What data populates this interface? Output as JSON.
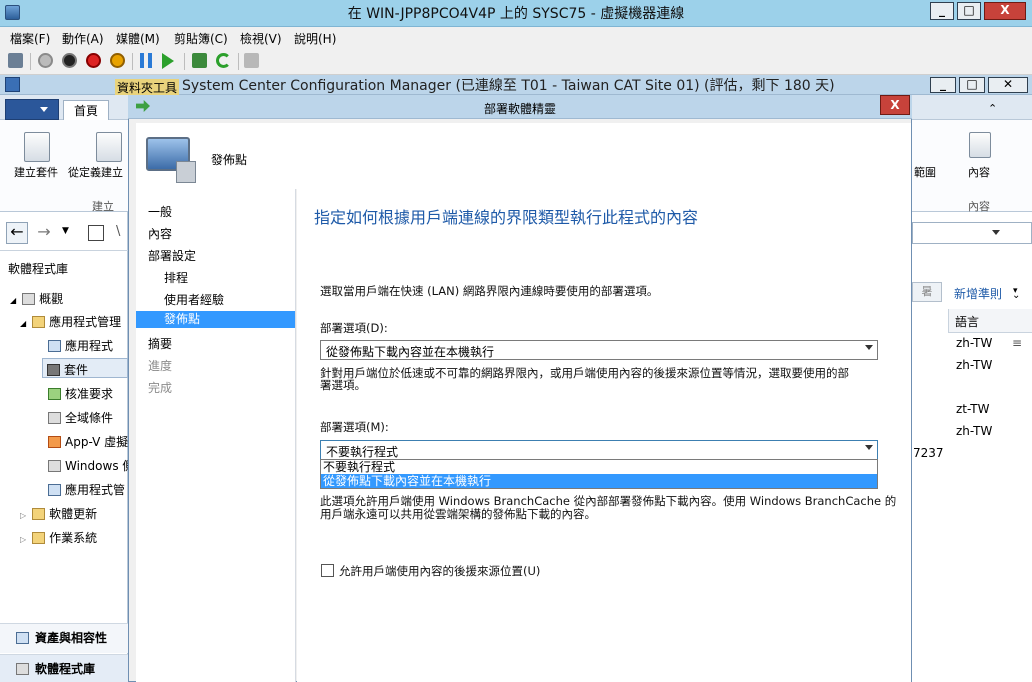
{
  "vm": {
    "title": "在 WIN-JPP8PCO4V4P 上的 SYSC75 - 虛擬機器連線",
    "win_min": "_",
    "win_max": "□",
    "win_close": "X",
    "menu": [
      "檔案(F)",
      "動作(A)",
      "媒體(M)",
      "剪貼簿(C)",
      "檢視(V)",
      "說明(H)"
    ]
  },
  "sccm": {
    "folder_tools": "資料夾工具",
    "title": "System Center Configuration Manager (已連線至 T01 - Taiwan CAT Site 01) (評估，剩下 180 天)",
    "home_tab": "首頁",
    "ribbon_create_package": "建立套件",
    "ribbon_create_from_def": "從定義建立",
    "ribbon_group_create": "建立",
    "ribbon_scope": "範圍",
    "ribbon_content": "內容",
    "ribbon_group_content": "內容",
    "nav_title": "軟體程式庫",
    "tree": {
      "overview": "概觀",
      "app_mgmt": "應用程式管理",
      "applications": "應用程式",
      "packages": "套件",
      "approval": "核准要求",
      "global_conditions": "全域條件",
      "appv": "App-V 虛擬",
      "windows_side": "Windows 側",
      "app_mgmt2": "應用程式管",
      "software_updates": "軟體更新",
      "os": "作業系統"
    },
    "ws_assets": "資產與相容性",
    "ws_library": "軟體程式庫",
    "right": {
      "new_rule": "新增準則",
      "filter_btn": "暑",
      "col_lang": "語言",
      "rows": [
        "zh-TW",
        "zh-TW",
        "zt-TW",
        "zh-TW"
      ],
      "partial_id": "7237"
    }
  },
  "wizard": {
    "title": "部署軟體精靈",
    "close": "X",
    "page_header": "發佈點",
    "steps": [
      {
        "label": "一般"
      },
      {
        "label": "內容"
      },
      {
        "label": "部署設定"
      },
      {
        "label": "排程"
      },
      {
        "label": "使用者經驗"
      },
      {
        "label": "發佈點"
      },
      {
        "label": "摘要"
      },
      {
        "label": "進度"
      },
      {
        "label": "完成"
      }
    ],
    "heading": "指定如何根據用戶端連線的界限類型執行此程式的內容",
    "fast_desc": "選取當用戶端在快速 (LAN) 網路界限內連線時要使用的部署選項。",
    "option_d_label": "部署選項(D):",
    "option_d_value": "從發佈點下載內容並在本機執行",
    "slow_desc_1": "針對用戶端位於低速或不可靠的網路界限內，或用戶端使用內容的後援來源位置等情況，選取要使用的部",
    "slow_desc_2": "署選項。",
    "option_m_label": "部署選項(M):",
    "option_m_value": "不要執行程式",
    "dropdown_options": [
      "不要執行程式",
      "從發佈點下載內容並在本機執行"
    ],
    "branch_desc_1": "此選項允許用戶端使用 Windows BranchCache 從內部部署發佈點下載內容。使用 Windows BranchCache 的",
    "branch_desc_2": "用戶端永遠可以共用從雲端架構的發佈點下載的內容。",
    "fallback_label": "允許用戶端使用內容的後援來源位置(U)"
  }
}
